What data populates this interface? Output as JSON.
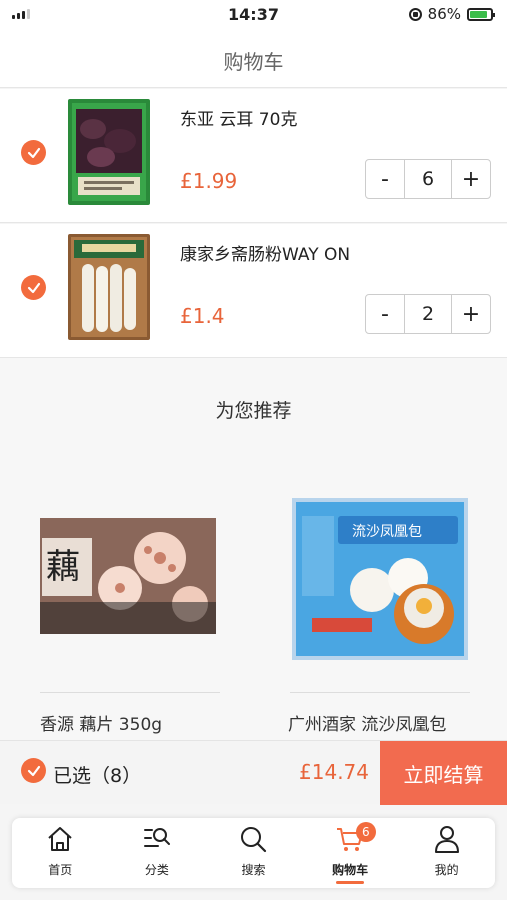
{
  "status_bar": {
    "time": "14:37",
    "battery": "86%"
  },
  "header": {
    "title": "购物车"
  },
  "cart": {
    "items": [
      {
        "name": "东亚 云耳 70克",
        "price": "£1.99",
        "quantity": "6",
        "decrease": "-",
        "increase": "+"
      },
      {
        "name": "康家乡斋肠粉WAY ON",
        "price": "£1.4",
        "quantity": "2",
        "decrease": "-",
        "increase": "+"
      }
    ]
  },
  "recommend": {
    "title": "为您推荐",
    "items": [
      {
        "name": "香源 藕片 350g"
      },
      {
        "name": "广州酒家 流沙凤凰包"
      }
    ]
  },
  "checkout": {
    "selected_label": "已选（8）",
    "total": "£14.74",
    "button": "立即结算"
  },
  "tabs": [
    {
      "label": "首页",
      "icon": "home-icon"
    },
    {
      "label": "分类",
      "icon": "category-search-icon"
    },
    {
      "label": "搜索",
      "icon": "search-icon"
    },
    {
      "label": "购物车",
      "icon": "cart-icon",
      "badge": "6",
      "active": true
    },
    {
      "label": "我的",
      "icon": "user-icon"
    }
  ],
  "colors": {
    "accent": "#f26b3d",
    "price": "#e8643a"
  }
}
